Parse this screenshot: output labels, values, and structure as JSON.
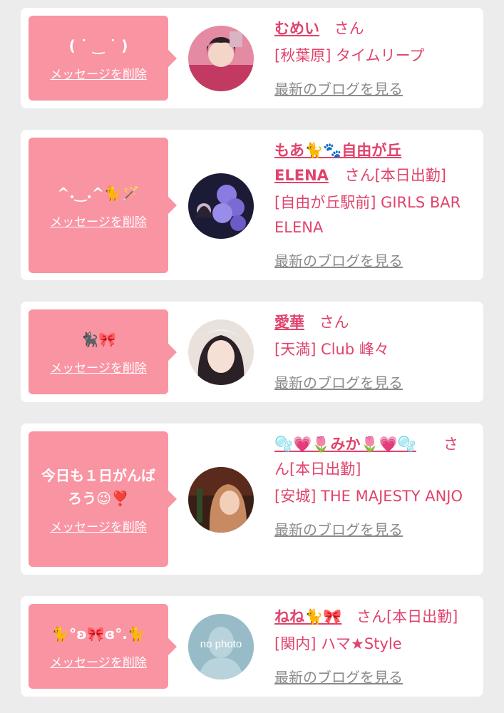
{
  "cards": [
    {
      "message": "( ˙ ‿ ˙ )",
      "delete_label": "メッセージを削除",
      "name": "むめい",
      "honorific": "さん",
      "status": "",
      "shop": "[秋葉原] タイムリープ",
      "blog_label": "最新のブログを見る",
      "avatar_icon": "avatar-photo"
    },
    {
      "message": "^.‿.^🐈🪄",
      "delete_label": "メッセージを削除",
      "name_line1": "もあ🐈🐾自由が丘",
      "name_line2": "ELENA",
      "honorific": "さん",
      "status": "[本日出勤]",
      "shop": "[自由が丘駅前] GIRLS BAR ELENA",
      "blog_label": "最新のブログを見る",
      "avatar_icon": "avatar-photo"
    },
    {
      "message": "🐈‍⬛🎀",
      "delete_label": "メッセージを削除",
      "name": "愛華",
      "honorific": "さん",
      "status": "",
      "shop": "[天満] Club 峰々",
      "blog_label": "最新のブログを見る",
      "avatar_icon": "avatar-photo"
    },
    {
      "message": "今日も１日がんばろう😉❣️",
      "delete_label": "メッセージを削除",
      "name": "🫧💗🌷みか🌷💗🫧",
      "honorific_line1": "さ",
      "honorific_line2": "ん",
      "status": "[本日出勤]",
      "shop": "[安城] THE MAJESTY ANJO",
      "blog_label": "最新のブログを見る",
      "avatar_icon": "avatar-photo"
    },
    {
      "message": "🐈°ʚ🎀ɞ°.🐈",
      "delete_label": "メッセージを削除",
      "name": "ねね🐈🎀",
      "honorific": "さん",
      "status": "[本日出勤]",
      "shop": "[関内] ハマ★Style",
      "blog_label": "最新のブログを見る",
      "avatar_text": "no photo",
      "avatar_icon": "no-photo-placeholder"
    }
  ],
  "colors": {
    "accent": "#e0436b",
    "bubble": "#f994a3",
    "link_gray": "#8a8a8a",
    "background": "#ececec"
  }
}
